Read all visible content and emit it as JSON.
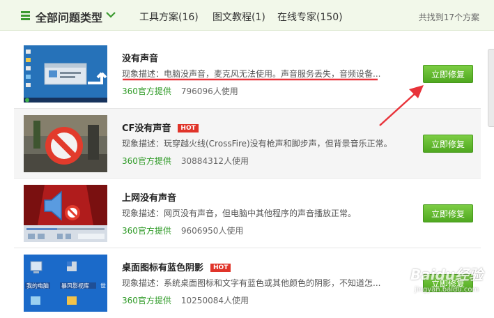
{
  "header": {
    "category_title": "全部问题类型",
    "tabs": [
      {
        "label": "工具方案(16)"
      },
      {
        "label": "图文教程(1)"
      },
      {
        "label": "在线专家(150)"
      }
    ],
    "result_count": "共找到17个方案"
  },
  "items": [
    {
      "title": "没有声音",
      "hot": "",
      "description": "现象描述：电脑没声音，麦克风无法使用。声音服务丢失，音频设备...",
      "provider": "360官方提供",
      "uses": "796096人使用",
      "button": "立即修复",
      "thumb_icon": "desktop-screenshot-icon"
    },
    {
      "title": "CF没有声音",
      "hot": "HOT",
      "description": "现象描述：玩穿越火线(CrossFire)没有枪声和脚步声，但背景音乐正常。",
      "provider": "360官方提供",
      "uses": "30884312人使用",
      "button": "立即修复",
      "thumb_icon": "no-sound-prohibited-icon"
    },
    {
      "title": "上网没有声音",
      "hot": "",
      "description": "现象描述：网页没有声音，但电脑中其他程序的声音播放正常。",
      "provider": "360官方提供",
      "uses": "9606950人使用",
      "button": "立即修复",
      "thumb_icon": "muted-speaker-icon"
    },
    {
      "title": "桌面图标有蓝色阴影",
      "hot": "HOT",
      "description": "现象描述：系统桌面图标和文字有蓝色或其他颜色的阴影，不知道怎...",
      "provider": "360官方提供",
      "uses": "10250084人使用",
      "button": "立即修复",
      "thumb_icon": "desktop-icons-icon"
    }
  ],
  "desktop_icon_labels": [
    "我的电脑",
    "暴风影视库",
    "世"
  ],
  "watermark": {
    "text": "Baidu经验",
    "url": "jingyan.baidu.com"
  },
  "colors": {
    "accent_green": "#4fa820",
    "provider_green": "#2e9a26",
    "hot_red": "#e0342a",
    "annotation_red": "#e8333a"
  }
}
